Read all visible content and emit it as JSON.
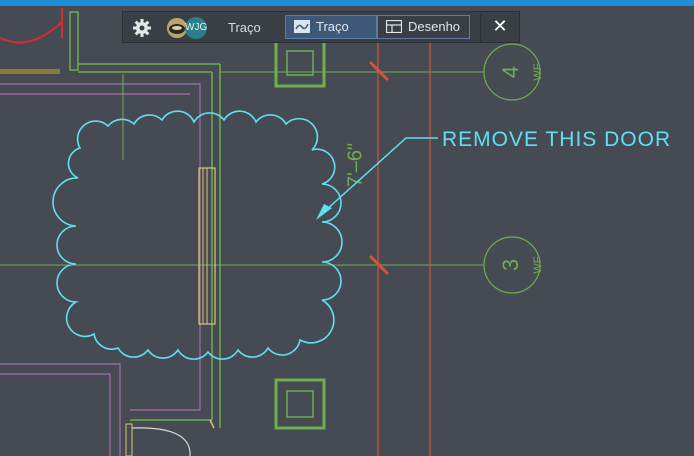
{
  "toolbar": {
    "avatar_initials": "WJG",
    "trace_label": "Traço",
    "tabs": [
      {
        "label": "Traço",
        "icon": "trace-icon",
        "active": true
      },
      {
        "label": "Desenho",
        "icon": "drawing-icon",
        "active": false
      }
    ],
    "close_label": "✕"
  },
  "drawing": {
    "annotation": "REMOVE THIS DOOR",
    "dimension": "7'–6\"",
    "grid_bubbles": [
      {
        "number": "4",
        "suffix": "WF"
      },
      {
        "number": "3",
        "suffix": "WF"
      }
    ]
  },
  "colors": {
    "background": "#464b53",
    "accent_bar": "#1e8fd6",
    "markup_cyan": "#5fe0f0",
    "grid_green": "#6fae4f",
    "gridline_red": "#d2553a"
  }
}
